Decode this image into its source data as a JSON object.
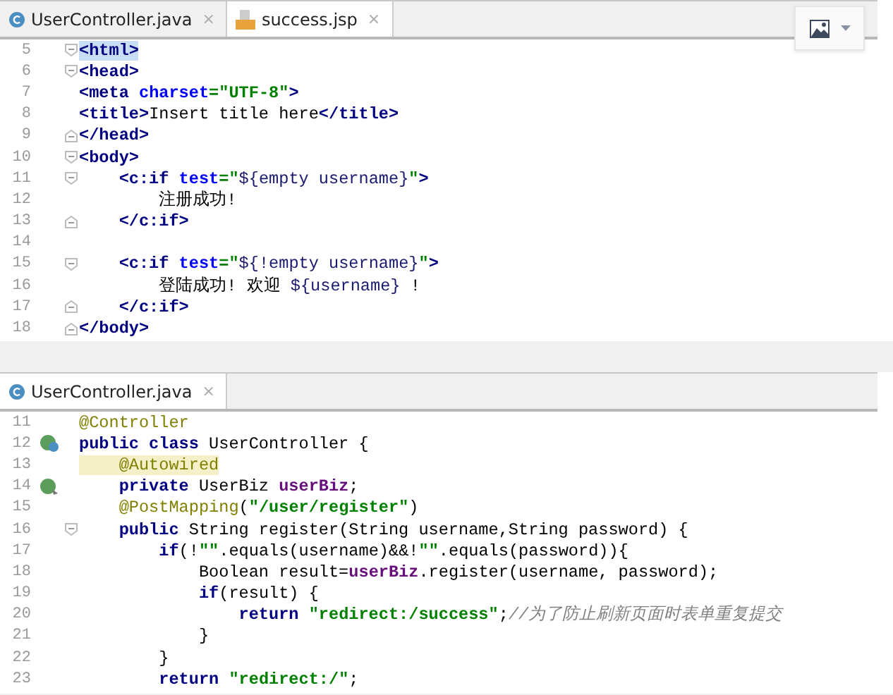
{
  "editors": [
    {
      "tabs": [
        {
          "label": "UserController.java",
          "kind": "java-class",
          "close": "×",
          "selected": false
        },
        {
          "label": "success.jsp",
          "kind": "jsp",
          "close": "×",
          "selected": true
        }
      ],
      "lines": [
        {
          "number": "5",
          "fold": {
            "kind": "start"
          },
          "tokens": [
            {
              "kind": "tag-match",
              "text": "<html>"
            }
          ]
        },
        {
          "number": "6",
          "fold": {
            "kind": "start"
          },
          "tokens": [
            {
              "kind": "tag",
              "text": "<head>"
            }
          ]
        },
        {
          "number": "7",
          "tokens": [
            {
              "kind": "tag",
              "text": "<meta "
            },
            {
              "kind": "attr",
              "text": "charset"
            },
            {
              "kind": "string",
              "text": "=\"UTF-8\""
            },
            {
              "kind": "tag",
              "text": ">"
            }
          ]
        },
        {
          "number": "8",
          "tokens": [
            {
              "kind": "tag",
              "text": "<title>"
            },
            {
              "kind": "plain",
              "text": "Insert title here"
            },
            {
              "kind": "tag",
              "text": "</title>"
            }
          ]
        },
        {
          "number": "9",
          "fold": {
            "kind": "end"
          },
          "tokens": [
            {
              "kind": "tag",
              "text": "</head>"
            }
          ]
        },
        {
          "number": "10",
          "fold": {
            "kind": "start"
          },
          "tokens": [
            {
              "kind": "tag",
              "text": "<body>"
            }
          ]
        },
        {
          "number": "11",
          "fold": {
            "kind": "start"
          },
          "tokens": [
            {
              "kind": "tag",
              "text": "    <c:if "
            },
            {
              "kind": "attr",
              "text": "test"
            },
            {
              "kind": "string",
              "text": "=\""
            },
            {
              "kind": "el",
              "text": "${empty username}"
            },
            {
              "kind": "string",
              "text": "\""
            },
            {
              "kind": "tag",
              "text": ">"
            }
          ]
        },
        {
          "number": "12",
          "tokens": [
            {
              "kind": "plain",
              "text": "        注册成功!"
            }
          ]
        },
        {
          "number": "13",
          "fold": {
            "kind": "end"
          },
          "tokens": [
            {
              "kind": "tag",
              "text": "    </c:if>"
            }
          ]
        },
        {
          "number": "14"
        },
        {
          "number": "15",
          "fold": {
            "kind": "start"
          },
          "tokens": [
            {
              "kind": "tag",
              "text": "    <c:if "
            },
            {
              "kind": "attr",
              "text": "test"
            },
            {
              "kind": "string",
              "text": "=\""
            },
            {
              "kind": "el",
              "text": "${!empty username}"
            },
            {
              "kind": "string",
              "text": "\""
            },
            {
              "kind": "tag",
              "text": ">"
            }
          ]
        },
        {
          "number": "16",
          "tokens": [
            {
              "kind": "plain",
              "text": "        登陆成功! 欢迎 "
            },
            {
              "kind": "el",
              "text": "${username}"
            },
            {
              "kind": "plain",
              "text": " !"
            }
          ]
        },
        {
          "number": "17",
          "fold": {
            "kind": "end"
          },
          "tokens": [
            {
              "kind": "tag",
              "text": "    </c:if>"
            }
          ]
        },
        {
          "number": "18",
          "fold": {
            "kind": "end"
          },
          "tokens": [
            {
              "kind": "tag",
              "text": "</body>"
            }
          ]
        }
      ]
    },
    {
      "tabs": [
        {
          "label": "UserController.java",
          "kind": "java-class",
          "close": "×",
          "selected": true
        }
      ],
      "lines": [
        {
          "number": "11",
          "tokens": [
            {
              "kind": "annotation",
              "text": "@Controller"
            }
          ]
        },
        {
          "number": "12",
          "gutter": {
            "kind": "class-bean"
          },
          "tokens": [
            {
              "kind": "keyword",
              "text": "public class "
            },
            {
              "kind": "plain",
              "text": "UserController {"
            }
          ]
        },
        {
          "number": "13",
          "tokens": [
            {
              "kind": "annotation-mark",
              "text": "    @Autowired"
            }
          ]
        },
        {
          "number": "14",
          "gutter": {
            "kind": "injected-bean"
          },
          "tokens": [
            {
              "kind": "keyword",
              "text": "    private "
            },
            {
              "kind": "plain",
              "text": "UserBiz "
            },
            {
              "kind": "field",
              "text": "userBiz"
            },
            {
              "kind": "plain",
              "text": ";"
            }
          ]
        },
        {
          "number": "15",
          "tokens": [
            {
              "kind": "annotation",
              "text": "    @PostMapping"
            },
            {
              "kind": "plain",
              "text": "("
            },
            {
              "kind": "string",
              "text": "\"/user/register\""
            },
            {
              "kind": "plain",
              "text": ")"
            }
          ]
        },
        {
          "number": "16",
          "fold": {
            "kind": "start"
          },
          "tokens": [
            {
              "kind": "keyword",
              "text": "    public "
            },
            {
              "kind": "plain",
              "text": "String register(String username,String password) {"
            }
          ]
        },
        {
          "number": "17",
          "tokens": [
            {
              "kind": "keyword",
              "text": "        if"
            },
            {
              "kind": "plain",
              "text": "(!"
            },
            {
              "kind": "string",
              "text": "\"\""
            },
            {
              "kind": "plain",
              "text": ".equals(username)&&!"
            },
            {
              "kind": "string",
              "text": "\"\""
            },
            {
              "kind": "plain",
              "text": ".equals(password)){"
            }
          ]
        },
        {
          "number": "18",
          "tokens": [
            {
              "kind": "plain",
              "text": "            Boolean result="
            },
            {
              "kind": "field",
              "text": "userBiz"
            },
            {
              "kind": "plain",
              "text": ".register(username, password);"
            }
          ]
        },
        {
          "number": "19",
          "tokens": [
            {
              "kind": "keyword",
              "text": "            if"
            },
            {
              "kind": "plain",
              "text": "(result) {"
            }
          ]
        },
        {
          "number": "20",
          "tokens": [
            {
              "kind": "keyword",
              "text": "                return "
            },
            {
              "kind": "string",
              "text": "\"redirect:/success\""
            },
            {
              "kind": "plain",
              "text": ";"
            },
            {
              "kind": "comment",
              "text": "//为了防止刷新页面时表单重复提交"
            }
          ]
        },
        {
          "number": "21",
          "tokens": [
            {
              "kind": "plain",
              "text": "            }"
            }
          ]
        },
        {
          "number": "22",
          "tokens": [
            {
              "kind": "plain",
              "text": "        }"
            }
          ]
        },
        {
          "number": "23",
          "tokens": [
            {
              "kind": "keyword",
              "text": "        return "
            },
            {
              "kind": "string",
              "text": "\"redirect:/\""
            },
            {
              "kind": "plain",
              "text": ";"
            }
          ]
        }
      ]
    }
  ]
}
